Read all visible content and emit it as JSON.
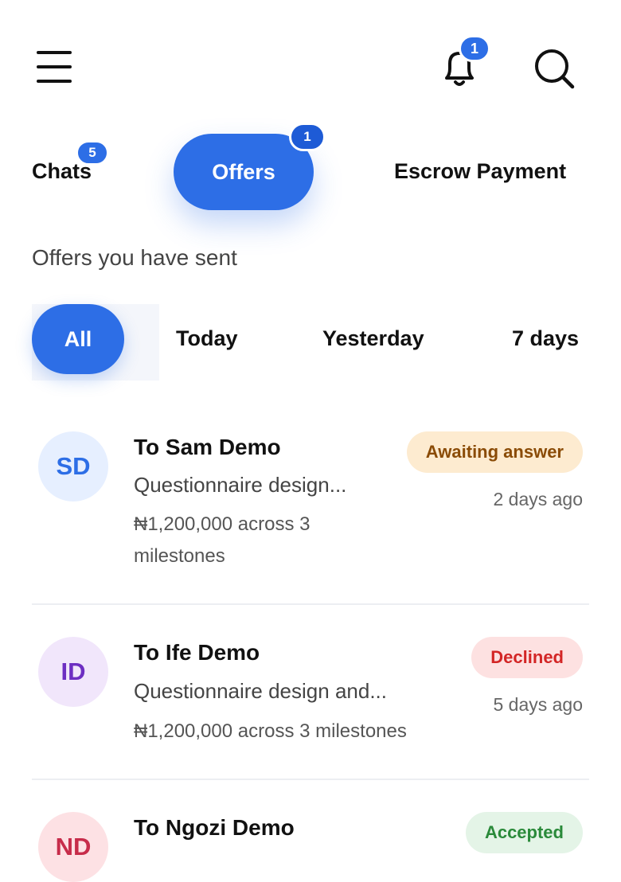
{
  "header": {
    "notification_count": "1"
  },
  "tabs": {
    "chats": {
      "label": "Chats",
      "badge": "5"
    },
    "offers": {
      "label": "Offers",
      "badge": "1"
    },
    "escrow": {
      "label": "Escrow Payment"
    }
  },
  "section_title": "Offers you have sent",
  "filters": [
    "All",
    "Today",
    "Yesterday",
    "7 days"
  ],
  "offers": [
    {
      "initials": "SD",
      "name": "To Sam Demo",
      "description": "Questionnaire design...",
      "price_line1": "₦1,200,000 across 3",
      "price_line2": "milestones",
      "status": "Awaiting answer",
      "time": "2 days ago",
      "colors": {
        "avatar_bg": "#e6efff",
        "avatar_fg": "#2d6ee6",
        "status_bg": "#fdebd0",
        "status_fg": "#8a4b06"
      }
    },
    {
      "initials": "ID",
      "name": "To Ife Demo",
      "description": "Questionnaire design and...",
      "price_line1": "₦1,200,000 across 3 milestones",
      "status": "Declined",
      "time": "5 days ago",
      "colors": {
        "avatar_bg": "#f1e6fb",
        "avatar_fg": "#6d2ec2",
        "status_bg": "#fde1e1",
        "status_fg": "#d32626"
      }
    },
    {
      "initials": "ND",
      "name": "To Ngozi Demo",
      "status": "Accepted",
      "colors": {
        "avatar_bg": "#fde1e4",
        "avatar_fg": "#c72c4a",
        "status_bg": "#e4f4e7",
        "status_fg": "#2a8a3a"
      }
    }
  ],
  "icons": [
    "menu-icon",
    "bell-icon",
    "search-icon"
  ],
  "colors": {
    "accent": "#2d6ee6"
  }
}
